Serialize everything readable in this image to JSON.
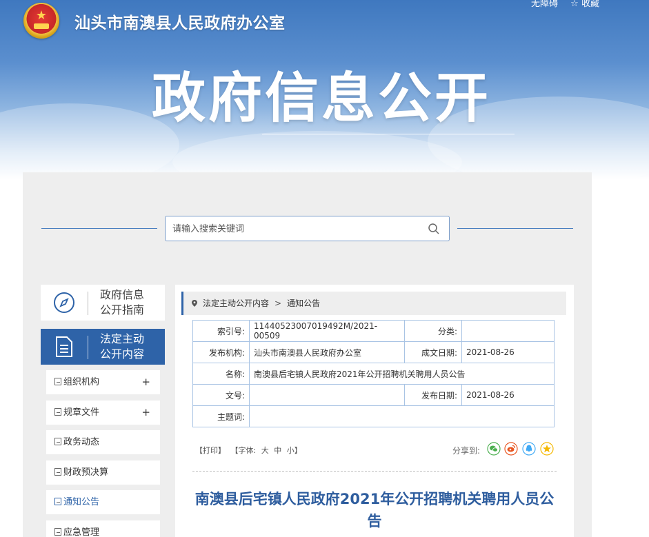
{
  "header": {
    "site_name": "汕头市南澳县人民政府办公室",
    "top_links": [
      "无障碍",
      "☆ 收藏"
    ],
    "big_title": "政府信息公开"
  },
  "search": {
    "placeholder": "请输入搜索关键词"
  },
  "sidebar": {
    "guide": {
      "line1": "政府信息",
      "line2": "公开指南"
    },
    "active": {
      "line1": "法定主动",
      "line2": "公开内容"
    },
    "items": [
      {
        "label": "组织机构",
        "expand": "+"
      },
      {
        "label": "规章文件",
        "expand": "+"
      },
      {
        "label": "政务动态",
        "expand": ""
      },
      {
        "label": "财政预决算",
        "expand": ""
      },
      {
        "label": "通知公告",
        "expand": ""
      },
      {
        "label": "应急管理",
        "expand": ""
      }
    ]
  },
  "breadcrumb": {
    "level1": "法定主动公开内容",
    "separator": ">",
    "level2": "通知公告"
  },
  "meta": {
    "index_label": "索引号:",
    "index_value": "11440523007019492M/2021-00509",
    "category_label": "分类:",
    "category_value": "",
    "publisher_label": "发布机构:",
    "publisher_value": "汕头市南澳县人民政府办公室",
    "written_label": "成文日期:",
    "written_value": "2021-08-26",
    "name_label": "名称:",
    "name_value": "南澳县后宅镇人民政府2021年公开招聘机关聘用人员公告",
    "docno_label": "文号:",
    "docno_value": "",
    "published_label": "发布日期:",
    "published_value": "2021-08-26",
    "keywords_label": "主题词:",
    "keywords_value": ""
  },
  "tools": {
    "print": "【打印】",
    "font_open": "【字体:",
    "large": "大",
    "medium": "中",
    "small": "小】",
    "share_label": "分享到:"
  },
  "share_colors": {
    "wechat": "#4caf50",
    "weibo": "#e8541e",
    "qq": "#3fa9f5",
    "qzone": "#f5b800"
  },
  "article": {
    "title": "南澳县后宅镇人民政府2021年公开招聘机关聘用人员公告"
  }
}
